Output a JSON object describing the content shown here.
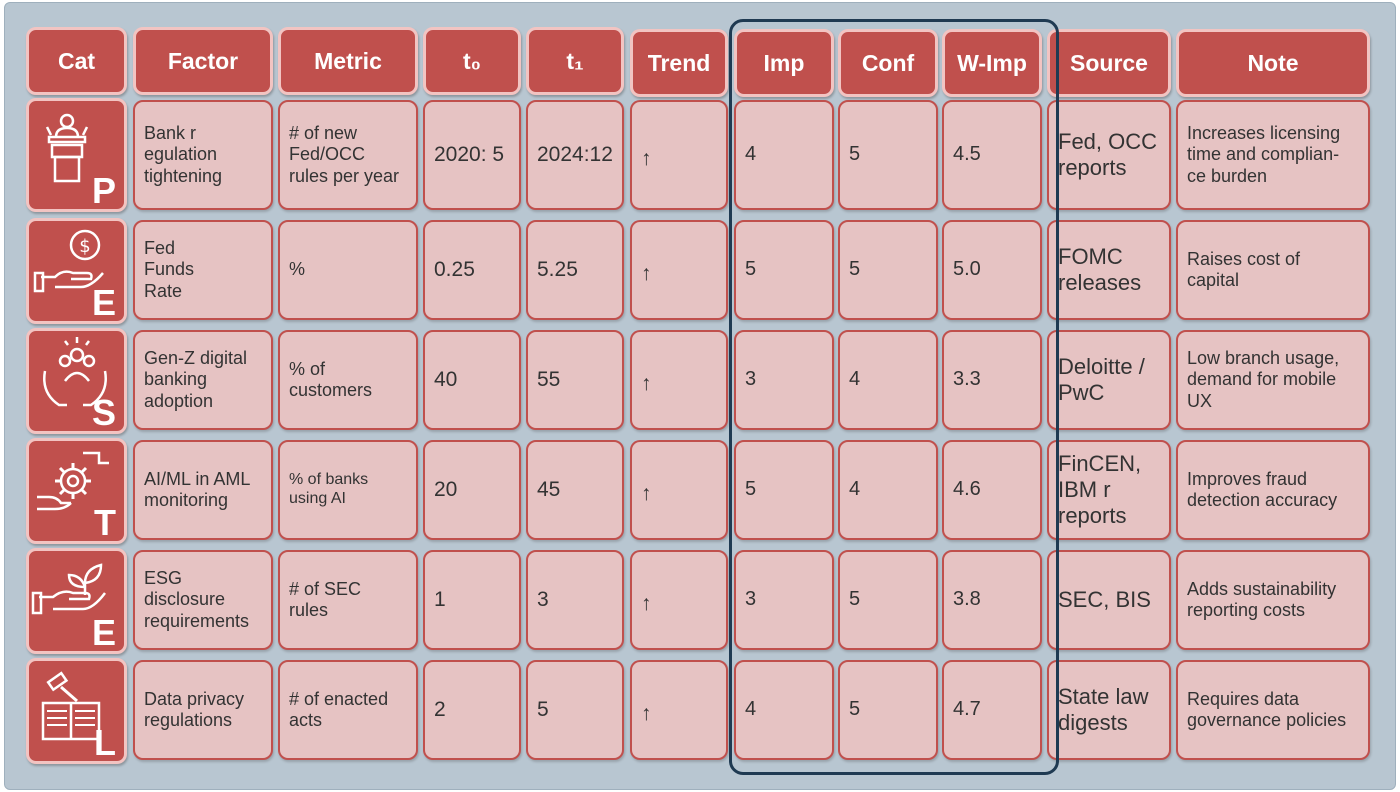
{
  "headers": {
    "cat": "Cat",
    "factor": "Factor",
    "metric": "Metric",
    "t0": "t₀",
    "t1": "t₁",
    "trend": "Trend",
    "imp": "Imp",
    "conf": "Conf",
    "wimp": "W-Imp",
    "source": "Source",
    "note": "Note"
  },
  "rows": [
    {
      "cat": "P",
      "icon": "podium-speaker-icon",
      "factor": "Bank r\negulation\ntightening",
      "metric": "# of new\nFed/OCC\nrules per year",
      "t0": "2020: 5",
      "t1": "2024:12",
      "trend": "↑",
      "imp": "4",
      "conf": "5",
      "wimp": "4.5",
      "source": "Fed, OCC\nreports",
      "note": "Increases licensing\ntime and complian-\nce burden"
    },
    {
      "cat": "E",
      "icon": "money-hand-icon",
      "factor": "Fed\nFunds\nRate",
      "metric": "%",
      "t0": "0.25",
      "t1": "5.25",
      "trend": "↑",
      "imp": "5",
      "conf": "5",
      "wimp": "5.0",
      "source": "FOMC\nreleases",
      "note": "Raises cost of\ncapital"
    },
    {
      "cat": "S",
      "icon": "people-hands-icon",
      "factor": "Gen-Z digital\nbanking\nadoption",
      "metric": "% of\ncustomers",
      "t0": "40",
      "t1": "55",
      "trend": "↑",
      "imp": "3",
      "conf": "4",
      "wimp": "3.3",
      "source": "Deloitte /\nPwC",
      "note": "Low branch usage,\ndemand for mobile\nUX"
    },
    {
      "cat": "T",
      "icon": "gear-hands-icon",
      "factor": "AI/ML in AML\nmonitoring",
      "metric": "% of banks\nusing AI",
      "t0": "20",
      "t1": "45",
      "trend": "↑",
      "imp": "5",
      "conf": "4",
      "wimp": "4.6",
      "source": "FinCEN,\nIBM r\nreports",
      "note": "Improves fraud\ndetection accuracy"
    },
    {
      "cat": "E",
      "icon": "plant-hand-icon",
      "factor": "ESG\ndisclosure\nrequirements",
      "metric": "# of SEC\nrules",
      "t0": "1",
      "t1": "3",
      "trend": "↑",
      "imp": "3",
      "conf": "5",
      "wimp": "3.8",
      "source": "SEC, BIS",
      "note": "Adds sustainability\nreporting costs"
    },
    {
      "cat": "L",
      "icon": "gavel-book-icon",
      "factor": "Data privacy\nregulations",
      "metric": "# of enacted\nacts",
      "t0": "2",
      "t1": "5",
      "trend": "↑",
      "imp": "4",
      "conf": "5",
      "wimp": "4.7",
      "source": "State law\ndigests",
      "note": "Requires data\ngovernance policies"
    }
  ],
  "colors": {
    "header": "#c0504d",
    "cell": "#e6c3c3",
    "border": "#c0504d",
    "background": "#b8c6d1",
    "highlight": "#1f3a52"
  }
}
